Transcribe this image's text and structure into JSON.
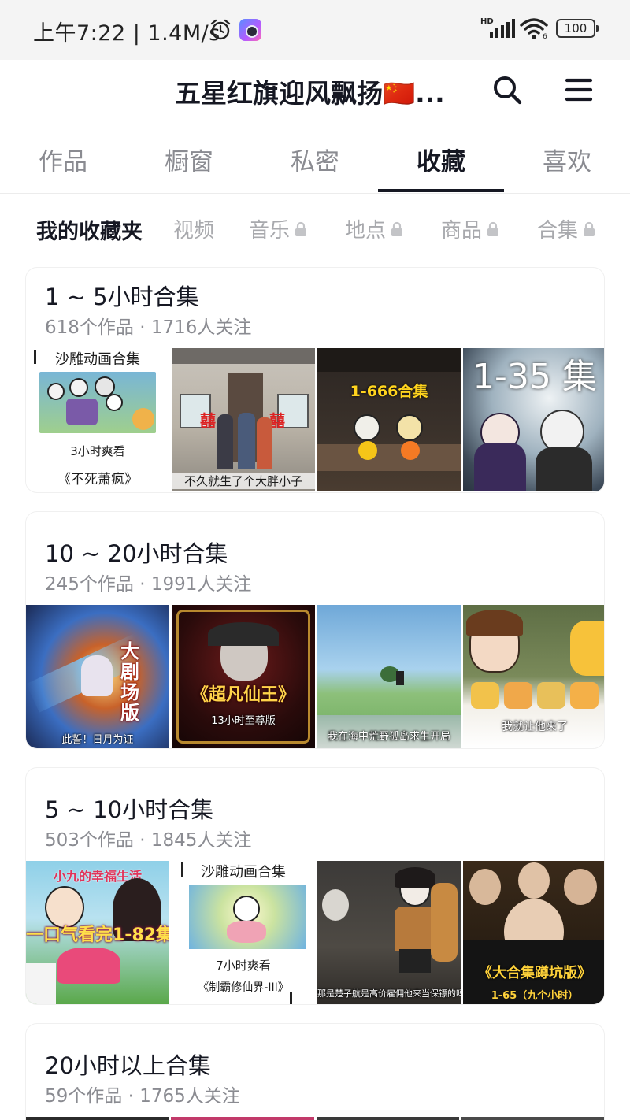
{
  "status_bar": {
    "time": "上午7:22",
    "speed": "1.4M/s",
    "battery": "100",
    "signal_label": "HD",
    "wifi_label": "6"
  },
  "header": {
    "title": "五星红旗迎风飘扬🇨🇳..."
  },
  "tabs": [
    {
      "label": "作品"
    },
    {
      "label": "橱窗"
    },
    {
      "label": "私密"
    },
    {
      "label": "收藏",
      "active": true
    },
    {
      "label": "喜欢"
    }
  ],
  "subtabs": [
    {
      "label": "我的收藏夹",
      "active": true
    },
    {
      "label": "视频"
    },
    {
      "label": "音乐",
      "locked": true
    },
    {
      "label": "地点",
      "locked": true
    },
    {
      "label": "商品",
      "locked": true
    },
    {
      "label": "合集",
      "locked": true
    }
  ],
  "collections": [
    {
      "title": "1 ~ 5小时合集",
      "meta": "618个作品 · 1716人关注",
      "thumbs": [
        {
          "top_caption": "沙雕动画合集",
          "mid_caption": "3小时爽看",
          "bottom_caption": "《不死萧疯》"
        },
        {
          "caption": "不久就生了个大胖小子"
        },
        {
          "caption": "1-666合集"
        },
        {
          "caption": "1-35 集"
        }
      ]
    },
    {
      "title": "10 ~ 20小时合集",
      "meta": "245个作品 · 1991人关注",
      "thumbs": [
        {
          "caption": "大剧场版",
          "sub_caption": "此誓！日月为证"
        },
        {
          "caption": "《超凡仙王》",
          "sub_caption": "13小时至尊版"
        },
        {
          "caption": "我在海中荒野孤岛求生开局"
        },
        {
          "caption": "我就让他来了"
        }
      ]
    },
    {
      "title": "5 ~ 10小时合集",
      "meta": "503个作品 · 1845人关注",
      "thumbs": [
        {
          "caption": "一口气看完1-82集",
          "sub_caption": "小九的幸福生活"
        },
        {
          "top_caption": "沙雕动画合集",
          "mid_caption": "7小时爽看",
          "bottom_caption": "《制霸修仙界-III》"
        },
        {
          "caption": "那是楚子航是高价雇佣他来当保镖的吗"
        },
        {
          "caption": "《大合集蹲坑版》",
          "sub_caption": "1-65（九个小时）"
        }
      ]
    },
    {
      "title": "20小时以上合集",
      "meta": "59个作品 · 1765人关注",
      "thumbs": []
    }
  ],
  "colors": {
    "primary_text": "#161823",
    "secondary_text": "#8a8b91",
    "inactive_subtab": "#a8a9ad",
    "flag_red": "#de2910"
  }
}
